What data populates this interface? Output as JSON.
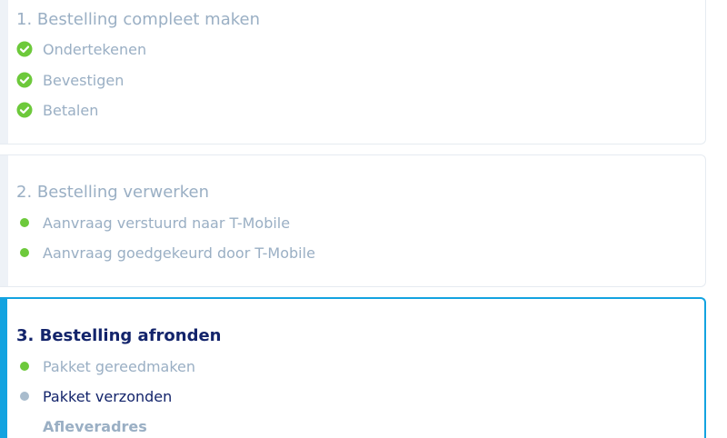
{
  "colors": {
    "done": "#6dc93b",
    "pending": "#a9bccd",
    "accent": "#13a3e0",
    "title_active": "#13246b",
    "title_inactive": "#9aafc4"
  },
  "sections": [
    {
      "title": "1. Bestelling compleet maken",
      "state": "done",
      "steps": [
        {
          "label": "Ondertekenen",
          "icon": "check-circle-icon",
          "status": "done"
        },
        {
          "label": "Bevestigen",
          "icon": "check-circle-icon",
          "status": "done"
        },
        {
          "label": "Betalen",
          "icon": "check-circle-icon",
          "status": "done"
        }
      ]
    },
    {
      "title": "2. Bestelling verwerken",
      "state": "done",
      "steps": [
        {
          "label": "Aanvraag verstuurd naar T-Mobile",
          "icon": "green-dot-icon",
          "status": "done"
        },
        {
          "label": "Aanvraag goedgekeurd door T-Mobile",
          "icon": "green-dot-icon",
          "status": "done"
        }
      ]
    },
    {
      "title": "3. Bestelling afronden",
      "state": "active",
      "steps": [
        {
          "label": "Pakket gereedmaken",
          "icon": "green-dot-icon",
          "status": "done"
        },
        {
          "label": "Pakket verzonden",
          "icon": "grey-dot-icon",
          "status": "current"
        },
        {
          "label": "Afleveradres",
          "icon": "",
          "status": "sub"
        }
      ]
    }
  ]
}
